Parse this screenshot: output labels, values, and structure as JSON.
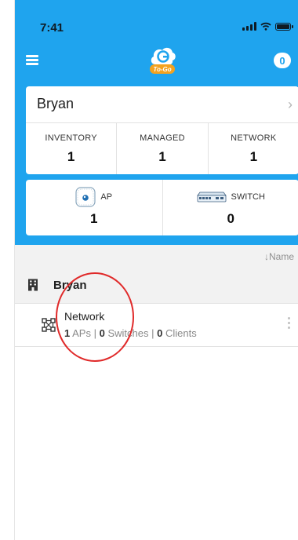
{
  "status_bar": {
    "time": "7:41"
  },
  "header": {
    "badge_count": "0",
    "logo_text": "To-Go"
  },
  "organization": {
    "name": "Bryan",
    "stats": [
      {
        "label": "INVENTORY",
        "value": "1"
      },
      {
        "label": "MANAGED",
        "value": "1"
      },
      {
        "label": "NETWORK",
        "value": "1"
      }
    ]
  },
  "devices": [
    {
      "label": "AP",
      "value": "1",
      "icon": "access-point-icon"
    },
    {
      "label": "SWITCH",
      "value": "0",
      "icon": "switch-icon"
    }
  ],
  "list": {
    "sort_label": "↓Name",
    "site": {
      "name": "Bryan",
      "icon": "building-icon"
    },
    "networks": [
      {
        "name": "Network",
        "aps_count": "1",
        "aps_label": "APs",
        "switches_count": "0",
        "switches_label": "Switches",
        "clients_count": "0",
        "clients_label": "Clients",
        "separator": " | "
      }
    ]
  },
  "colors": {
    "header": "#1fa4ee",
    "annotation": "#e02a2a",
    "background": "#ffffff"
  }
}
